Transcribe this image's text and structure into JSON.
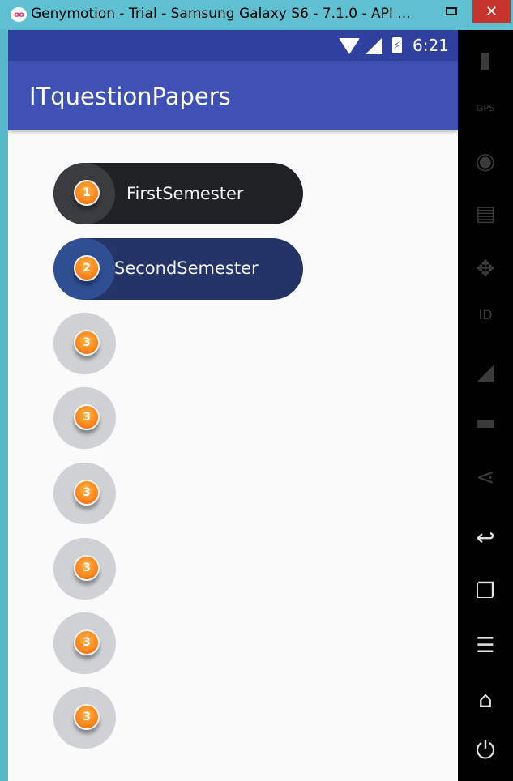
{
  "window": {
    "title": "Genymotion - Trial - Samsung Galaxy S6 - 7.1.0 - API ...",
    "minimize_label": "",
    "close_label": "✕",
    "app_icon_glyph": "oo"
  },
  "statusbar": {
    "time": "6:21",
    "battery_glyph": "⚡",
    "icons": [
      "wifi-icon",
      "signal-icon",
      "battery-icon"
    ]
  },
  "appbar": {
    "title": "ITquestionPapers"
  },
  "menu": {
    "items": [
      {
        "badge": "1",
        "label": "FirstSemester",
        "style": "dark"
      },
      {
        "badge": "2",
        "label": "SecondSemester",
        "style": "blue"
      },
      {
        "badge": "3",
        "label": "",
        "style": "plain"
      },
      {
        "badge": "3",
        "label": "",
        "style": "plain"
      },
      {
        "badge": "3",
        "label": "",
        "style": "plain"
      },
      {
        "badge": "3",
        "label": "",
        "style": "plain"
      },
      {
        "badge": "3",
        "label": "",
        "style": "plain"
      },
      {
        "badge": "3",
        "label": "",
        "style": "plain"
      }
    ]
  },
  "toolbar": {
    "items": [
      {
        "name": "battery-icon",
        "glyph": "▮"
      },
      {
        "name": "gps-icon",
        "glyph": "GPS"
      },
      {
        "name": "webcam-icon",
        "glyph": "◉"
      },
      {
        "name": "media-icon",
        "glyph": "▤"
      },
      {
        "name": "dpad-icon",
        "glyph": "✥"
      },
      {
        "name": "id-icon",
        "glyph": "ID"
      },
      {
        "name": "cast-icon",
        "glyph": "◢"
      },
      {
        "name": "sms-icon",
        "glyph": "▬"
      },
      {
        "name": "share-icon",
        "glyph": "⋖"
      },
      {
        "name": "back-icon",
        "glyph": "↩"
      },
      {
        "name": "recent-apps-icon",
        "glyph": "❐"
      },
      {
        "name": "menu-icon",
        "glyph": "☰"
      },
      {
        "name": "home-icon",
        "glyph": "⌂"
      },
      {
        "name": "power-icon",
        "glyph": "⏻"
      }
    ]
  },
  "colors": {
    "statusbar": "#30409f",
    "appbar": "#3f51b5",
    "window_frame": "#5ec0d1",
    "close_button": "#c7342b",
    "badge_orange": "#ff8a1d"
  }
}
